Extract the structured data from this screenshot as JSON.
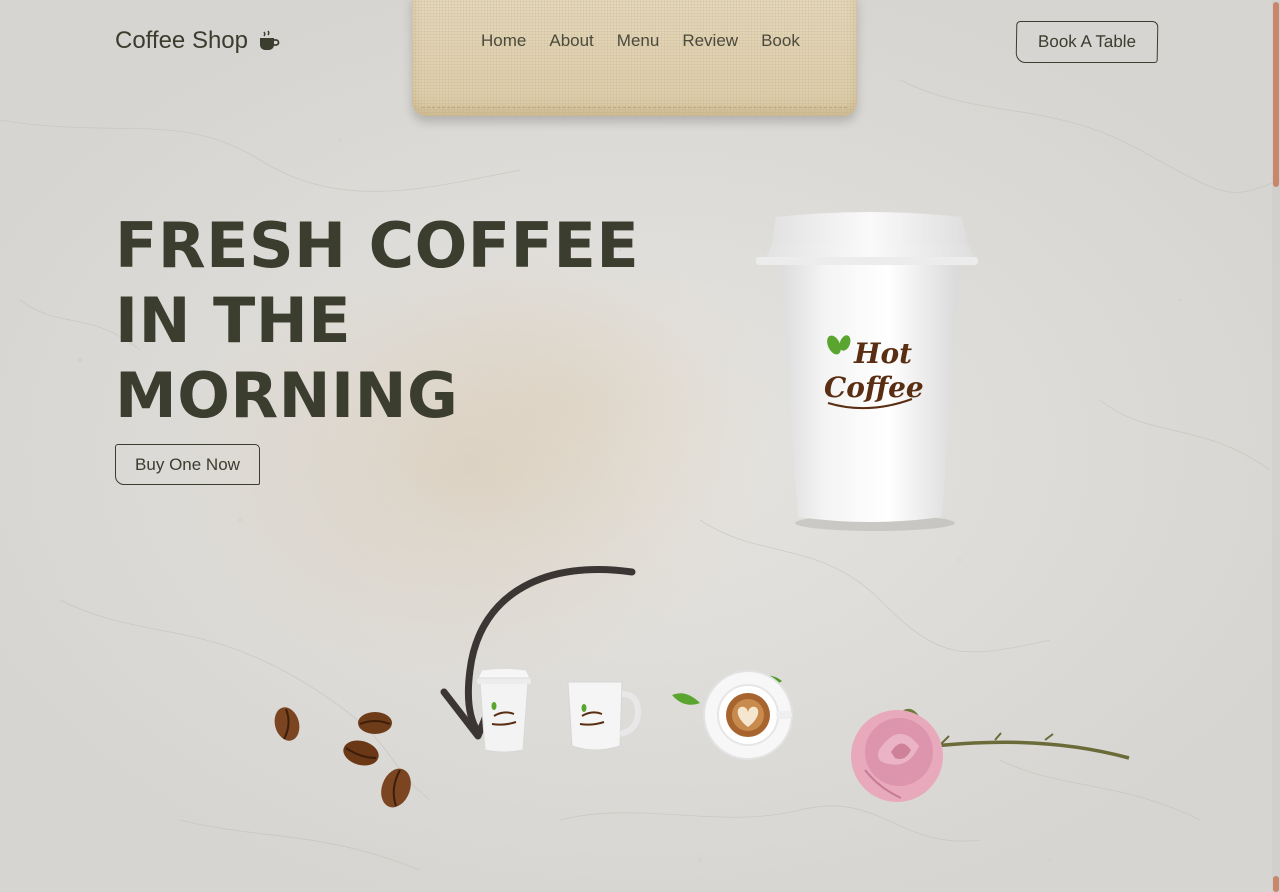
{
  "header": {
    "brand": "Coffee Shop",
    "brand_icon": "coffee-mug-icon",
    "nav": [
      "Home",
      "About",
      "Menu",
      "Review",
      "Book"
    ],
    "cta": "Book A Table"
  },
  "hero": {
    "title_lines": [
      "FRESH COFFEE",
      "IN THE",
      "MORNING"
    ],
    "cta": "Buy One Now"
  },
  "cup_logo": {
    "line1": "Hot",
    "line2": "Coffee"
  },
  "colors": {
    "text": "#3b3d2e",
    "accent": "#c8866a",
    "logo_brown": "#5a2e12",
    "logo_green": "#5aa52f"
  }
}
